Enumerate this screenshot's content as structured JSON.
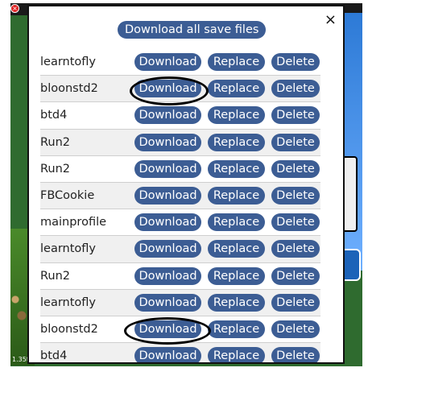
{
  "game": {
    "version_text": "1.35t"
  },
  "modal": {
    "close_glyph": "×",
    "download_all_label": "Download all save files"
  },
  "rows": [
    {
      "name": "learntofly"
    },
    {
      "name": "bloonstd2"
    },
    {
      "name": "btd4"
    },
    {
      "name": "Run2"
    },
    {
      "name": "Run2"
    },
    {
      "name": "FBCookie"
    },
    {
      "name": "mainprofile"
    },
    {
      "name": "learntofly"
    },
    {
      "name": "Run2"
    },
    {
      "name": "learntofly"
    },
    {
      "name": "bloonstd2"
    },
    {
      "name": "btd4"
    }
  ],
  "buttons": {
    "download": "Download",
    "replace": "Replace",
    "delete": "Delete"
  },
  "colors": {
    "button_bg": "#3c5d94",
    "row_alt": "#f0f0f0"
  }
}
